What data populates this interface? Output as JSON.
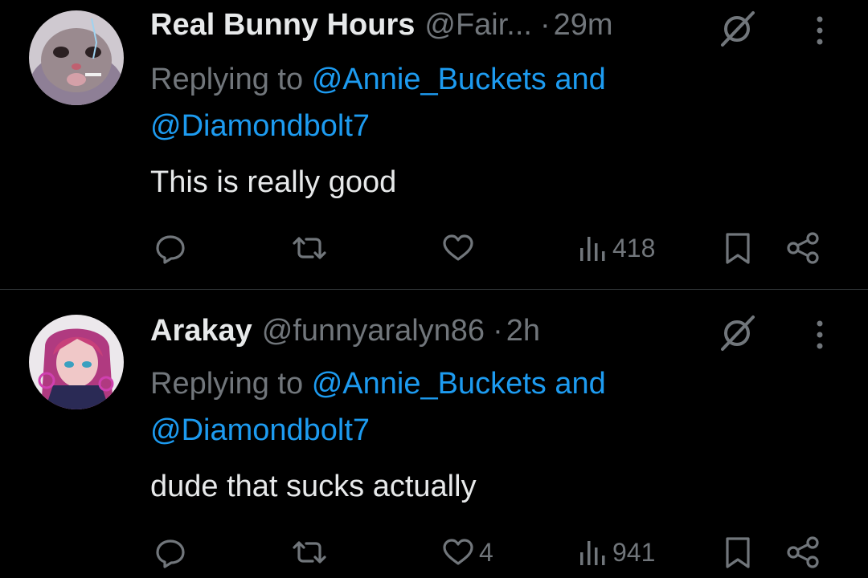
{
  "tweets": [
    {
      "name": "Real Bunny Hours",
      "handle": "@Fair...",
      "dot": "·",
      "time": "29m",
      "replying_prefix": "Replying to",
      "mention_1": "@Annie_Buckets",
      "conjunction": "and",
      "mention_2": "@Diamondbolt7",
      "text": "This is really good",
      "likes": "",
      "views": "418",
      "avatar": "bunny-avatar"
    },
    {
      "name": "Arakay",
      "handle": "@funnyaralyn86",
      "dot": "·",
      "time": "2h",
      "replying_prefix": "Replying to",
      "mention_1": "@Annie_Buckets",
      "conjunction": "and",
      "mention_2": "@Diamondbolt7",
      "text": "dude that sucks actually",
      "likes": "4",
      "views": "941",
      "avatar": "anime-avatar"
    }
  ],
  "colors": {
    "background": "#000000",
    "text": "#e7e9ea",
    "muted": "#71767b",
    "link": "#1d9bf0",
    "divider": "#2f3336"
  },
  "icons": [
    "reply-icon",
    "retweet-icon",
    "like-icon",
    "views-icon",
    "bookmark-icon",
    "share-icon",
    "grok-icon",
    "more-icon"
  ]
}
